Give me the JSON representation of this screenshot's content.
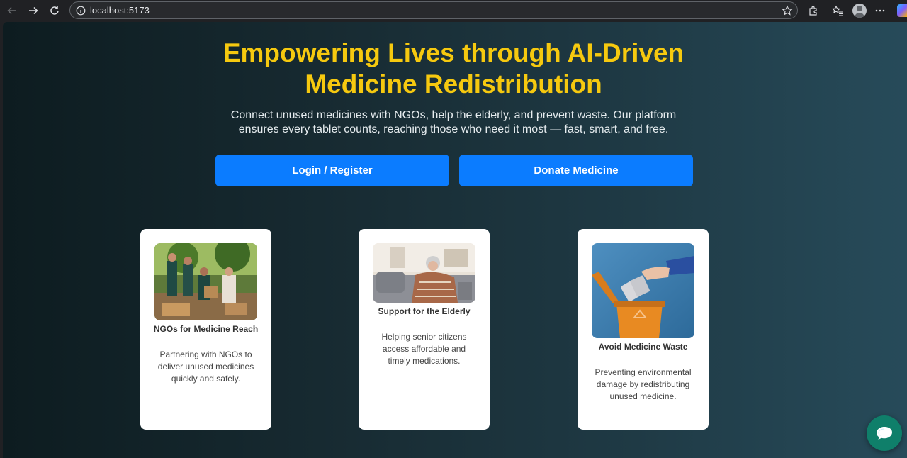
{
  "browser": {
    "url": "localhost:5173"
  },
  "hero": {
    "title_line1": "Empowering Lives through AI-Driven",
    "title_line2": "Medicine Redistribution",
    "subtitle_line1": "Connect unused medicines with NGOs, help the elderly, and prevent waste. Our platform",
    "subtitle_line2": "ensures every tablet counts, reaching those who need it most — fast, smart, and free."
  },
  "actions": {
    "login_label": "Login / Register",
    "donate_label": "Donate Medicine"
  },
  "cards": [
    {
      "title": "NGOs for Medicine Reach",
      "description": "Partnering with NGOs to deliver unused medicines quickly and safely."
    },
    {
      "title": "Support for the Elderly",
      "description": "Helping senior citizens access affordable and timely medications."
    },
    {
      "title": "Avoid Medicine Waste",
      "description": "Preventing environmental damage by redistributing unused medicine."
    }
  ],
  "colors": {
    "accent_yellow": "#f6c90f",
    "button_blue": "#0b7cff",
    "chat_green": "#0f7f6a"
  }
}
